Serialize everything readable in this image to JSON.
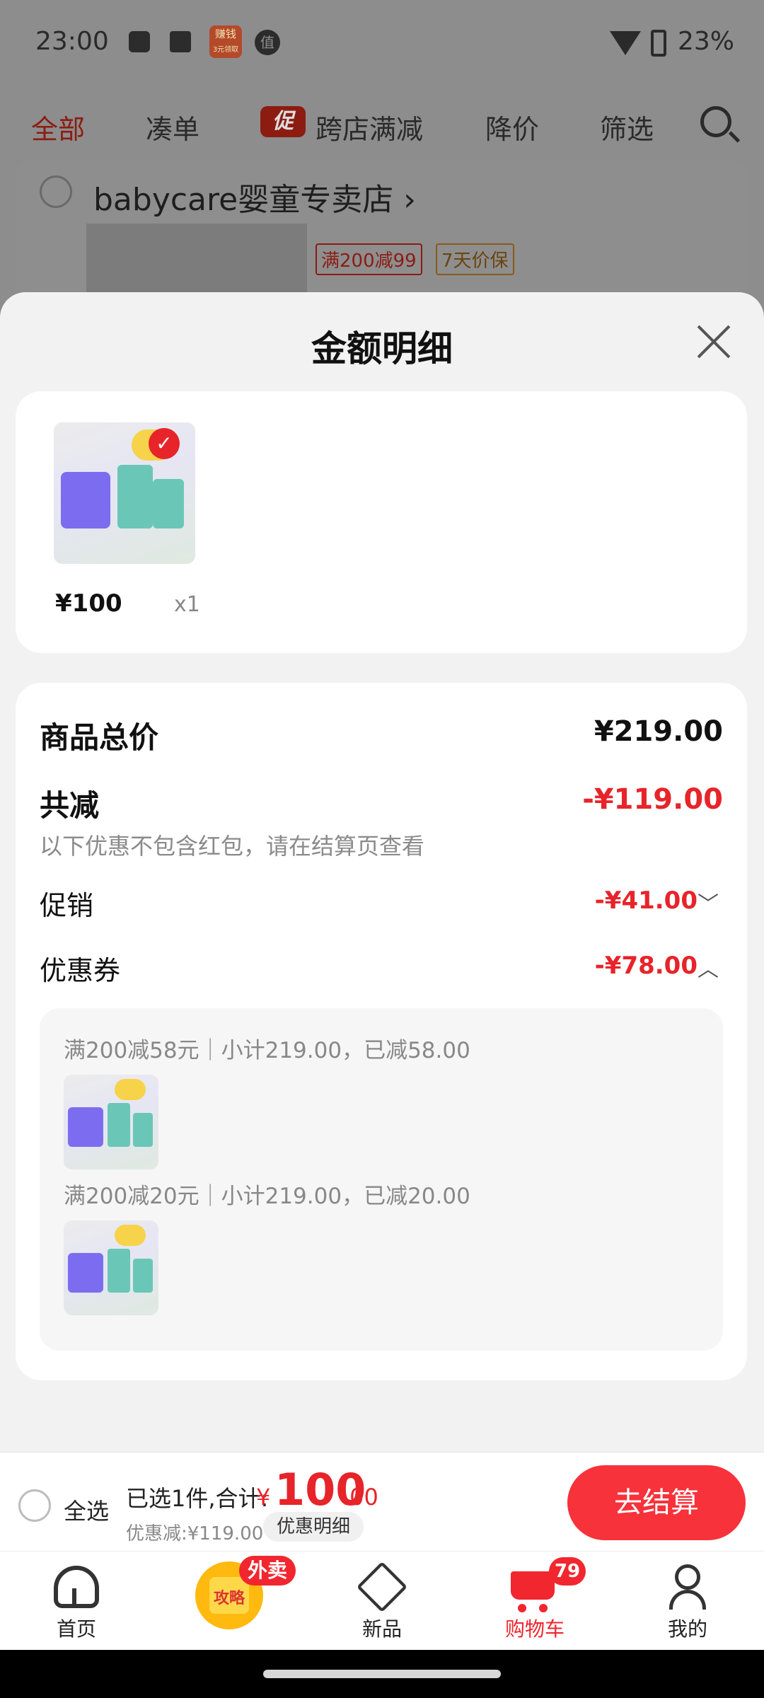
{
  "status": {
    "time": "23:00",
    "battery": "23%",
    "badge_line1": "赚钱",
    "badge_line2": "3元领取",
    "circle_icon": "值"
  },
  "tabs": {
    "all": "全部",
    "combine": "凑单",
    "promo_tag": "促",
    "cross_store": "跨店满减",
    "price_drop": "降价",
    "filter": "筛选"
  },
  "store": {
    "name": "babycare婴童专卖店 ›",
    "tag1": "满200减99",
    "tag2": "7天价保"
  },
  "sheet": {
    "title": "金额明细",
    "product": {
      "price": "¥100",
      "qty": "x1"
    },
    "summary": {
      "total_label": "商品总价",
      "total_value": "¥219.00",
      "reduce_label": "共减",
      "reduce_value": "-¥119.00",
      "reduce_note": "以下优惠不包含红包，请在结算页查看",
      "promo_label": "促销",
      "promo_value": "-¥41.00",
      "coupon_label": "优惠券",
      "coupon_value": "-¥78.00"
    },
    "coupons": [
      {
        "line": "满200减58元｜小计219.00，已减58.00"
      },
      {
        "line": "满200减20元｜小计219.00，已减20.00"
      }
    ]
  },
  "checkout": {
    "select_all": "全选",
    "selected_text": "已选1件,合计:",
    "currency": "¥",
    "amount_int": "100",
    "amount_dec": ".00",
    "discount_text": "优惠减:¥119.00",
    "detail_button": "优惠明细",
    "checkout_button": "去结算"
  },
  "bottom_nav": {
    "home": "首页",
    "guide": "攻略",
    "guide_badge": "外卖",
    "new": "新品",
    "cart": "购物车",
    "cart_badge": "79",
    "me": "我的"
  },
  "colors": {
    "accent": "#f1262f",
    "price_red": "#e7242a"
  }
}
